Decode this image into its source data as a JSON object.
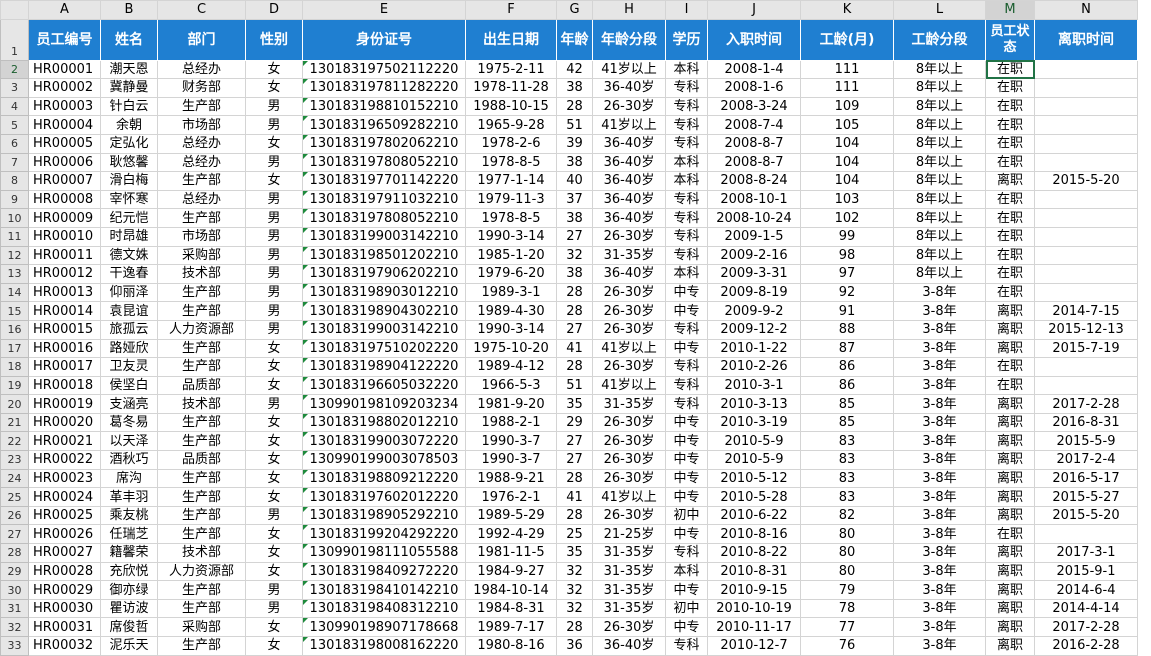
{
  "columns": [
    "A",
    "B",
    "C",
    "D",
    "E",
    "F",
    "G",
    "H",
    "I",
    "J",
    "K",
    "L",
    "M",
    "N"
  ],
  "header_row_number": "1",
  "headers": [
    "员工编号",
    "姓名",
    "部门",
    "性别",
    "身份证号",
    "出生日期",
    "年龄",
    "年龄分段",
    "学历",
    "入职时间",
    "工龄(月)",
    "工龄分段",
    "员工状态",
    "离职时间"
  ],
  "rows": [
    [
      "HR00001",
      "潮天恩",
      "总经办",
      "女",
      "130183197502112220",
      "1975-2-11",
      "42",
      "41岁以上",
      "本科",
      "2008-1-4",
      "111",
      "8年以上",
      "在职",
      ""
    ],
    [
      "HR00002",
      "冀静曼",
      "财务部",
      "女",
      "130183197811282220",
      "1978-11-28",
      "38",
      "36-40岁",
      "专科",
      "2008-1-6",
      "111",
      "8年以上",
      "在职",
      ""
    ],
    [
      "HR00003",
      "针白云",
      "生产部",
      "男",
      "130183198810152210",
      "1988-10-15",
      "28",
      "26-30岁",
      "专科",
      "2008-3-24",
      "109",
      "8年以上",
      "在职",
      ""
    ],
    [
      "HR00004",
      "余朝",
      "市场部",
      "男",
      "130183196509282210",
      "1965-9-28",
      "51",
      "41岁以上",
      "专科",
      "2008-7-4",
      "105",
      "8年以上",
      "在职",
      ""
    ],
    [
      "HR00005",
      "定弘化",
      "总经办",
      "女",
      "130183197802062210",
      "1978-2-6",
      "39",
      "36-40岁",
      "专科",
      "2008-8-7",
      "104",
      "8年以上",
      "在职",
      ""
    ],
    [
      "HR00006",
      "耿悠馨",
      "总经办",
      "男",
      "130183197808052210",
      "1978-8-5",
      "38",
      "36-40岁",
      "本科",
      "2008-8-7",
      "104",
      "8年以上",
      "在职",
      ""
    ],
    [
      "HR00007",
      "滑白梅",
      "生产部",
      "女",
      "130183197701142220",
      "1977-1-14",
      "40",
      "36-40岁",
      "本科",
      "2008-8-24",
      "104",
      "8年以上",
      "离职",
      "2015-5-20"
    ],
    [
      "HR00008",
      "宰怀寒",
      "总经办",
      "男",
      "130183197911032210",
      "1979-11-3",
      "37",
      "36-40岁",
      "专科",
      "2008-10-1",
      "103",
      "8年以上",
      "在职",
      ""
    ],
    [
      "HR00009",
      "纪元恺",
      "生产部",
      "男",
      "130183197808052210",
      "1978-8-5",
      "38",
      "36-40岁",
      "专科",
      "2008-10-24",
      "102",
      "8年以上",
      "在职",
      ""
    ],
    [
      "HR00010",
      "时昂雄",
      "市场部",
      "男",
      "130183199003142210",
      "1990-3-14",
      "27",
      "26-30岁",
      "专科",
      "2009-1-5",
      "99",
      "8年以上",
      "在职",
      ""
    ],
    [
      "HR00011",
      "德文姝",
      "采购部",
      "男",
      "130183198501202210",
      "1985-1-20",
      "32",
      "31-35岁",
      "专科",
      "2009-2-16",
      "98",
      "8年以上",
      "在职",
      ""
    ],
    [
      "HR00012",
      "干逸春",
      "技术部",
      "男",
      "130183197906202210",
      "1979-6-20",
      "38",
      "36-40岁",
      "本科",
      "2009-3-31",
      "97",
      "8年以上",
      "在职",
      ""
    ],
    [
      "HR00013",
      "仰丽泽",
      "生产部",
      "男",
      "130183198903012210",
      "1989-3-1",
      "28",
      "26-30岁",
      "中专",
      "2009-8-19",
      "92",
      "3-8年",
      "在职",
      ""
    ],
    [
      "HR00014",
      "袁昆谊",
      "生产部",
      "男",
      "130183198904302210",
      "1989-4-30",
      "28",
      "26-30岁",
      "中专",
      "2009-9-2",
      "91",
      "3-8年",
      "离职",
      "2014-7-15"
    ],
    [
      "HR00015",
      "旅孤云",
      "人力资源部",
      "男",
      "130183199003142210",
      "1990-3-14",
      "27",
      "26-30岁",
      "专科",
      "2009-12-2",
      "88",
      "3-8年",
      "离职",
      "2015-12-13"
    ],
    [
      "HR00016",
      "路娅欣",
      "生产部",
      "女",
      "130183197510202220",
      "1975-10-20",
      "41",
      "41岁以上",
      "中专",
      "2010-1-22",
      "87",
      "3-8年",
      "离职",
      "2015-7-19"
    ],
    [
      "HR00017",
      "卫友灵",
      "生产部",
      "女",
      "130183198904122220",
      "1989-4-12",
      "28",
      "26-30岁",
      "专科",
      "2010-2-26",
      "86",
      "3-8年",
      "在职",
      ""
    ],
    [
      "HR00018",
      "侯坚白",
      "品质部",
      "女",
      "130183196605032220",
      "1966-5-3",
      "51",
      "41岁以上",
      "专科",
      "2010-3-1",
      "86",
      "3-8年",
      "在职",
      ""
    ],
    [
      "HR00019",
      "支涵亮",
      "技术部",
      "男",
      "130990198109203234",
      "1981-9-20",
      "35",
      "31-35岁",
      "专科",
      "2010-3-13",
      "85",
      "3-8年",
      "离职",
      "2017-2-28"
    ],
    [
      "HR00020",
      "葛冬易",
      "生产部",
      "女",
      "130183198802012210",
      "1988-2-1",
      "29",
      "26-30岁",
      "中专",
      "2010-3-19",
      "85",
      "3-8年",
      "离职",
      "2016-8-31"
    ],
    [
      "HR00021",
      "以天泽",
      "生产部",
      "女",
      "130183199003072220",
      "1990-3-7",
      "27",
      "26-30岁",
      "中专",
      "2010-5-9",
      "83",
      "3-8年",
      "离职",
      "2015-5-9"
    ],
    [
      "HR00022",
      "酒秋巧",
      "品质部",
      "女",
      "130990199003078503",
      "1990-3-7",
      "27",
      "26-30岁",
      "中专",
      "2010-5-9",
      "83",
      "3-8年",
      "离职",
      "2017-2-4"
    ],
    [
      "HR00023",
      "席沟",
      "生产部",
      "女",
      "130183198809212220",
      "1988-9-21",
      "28",
      "26-30岁",
      "中专",
      "2010-5-12",
      "83",
      "3-8年",
      "离职",
      "2016-5-17"
    ],
    [
      "HR00024",
      "革丰羽",
      "生产部",
      "女",
      "130183197602012220",
      "1976-2-1",
      "41",
      "41岁以上",
      "中专",
      "2010-5-28",
      "83",
      "3-8年",
      "离职",
      "2015-5-27"
    ],
    [
      "HR00025",
      "乘友桃",
      "生产部",
      "男",
      "130183198905292210",
      "1989-5-29",
      "28",
      "26-30岁",
      "初中",
      "2010-6-22",
      "82",
      "3-8年",
      "离职",
      "2015-5-20"
    ],
    [
      "HR00026",
      "任瑞芝",
      "生产部",
      "女",
      "130183199204292220",
      "1992-4-29",
      "25",
      "21-25岁",
      "中专",
      "2010-8-16",
      "80",
      "3-8年",
      "在职",
      ""
    ],
    [
      "HR00027",
      "籍馨荣",
      "技术部",
      "女",
      "130990198111055588",
      "1981-11-5",
      "35",
      "31-35岁",
      "专科",
      "2010-8-22",
      "80",
      "3-8年",
      "离职",
      "2017-3-1"
    ],
    [
      "HR00028",
      "充欣悦",
      "人力资源部",
      "女",
      "130183198409272220",
      "1984-9-27",
      "32",
      "31-35岁",
      "本科",
      "2010-8-31",
      "80",
      "3-8年",
      "离职",
      "2015-9-1"
    ],
    [
      "HR00029",
      "御亦绿",
      "生产部",
      "男",
      "130183198410142210",
      "1984-10-14",
      "32",
      "31-35岁",
      "中专",
      "2010-9-15",
      "79",
      "3-8年",
      "离职",
      "2014-6-4"
    ],
    [
      "HR00030",
      "瞿访波",
      "生产部",
      "男",
      "130183198408312210",
      "1984-8-31",
      "32",
      "31-35岁",
      "初中",
      "2010-10-19",
      "78",
      "3-8年",
      "离职",
      "2014-4-14"
    ],
    [
      "HR00031",
      "席俊哲",
      "采购部",
      "女",
      "130990198907178668",
      "1989-7-17",
      "28",
      "26-30岁",
      "中专",
      "2010-11-17",
      "77",
      "3-8年",
      "离职",
      "2017-2-28"
    ],
    [
      "HR00032",
      "泥乐天",
      "生产部",
      "女",
      "130183198008162220",
      "1980-8-16",
      "36",
      "36-40岁",
      "专科",
      "2010-12-7",
      "76",
      "3-8年",
      "离职",
      "2016-2-28"
    ]
  ],
  "row_numbers": [
    "2",
    "3",
    "4",
    "5",
    "6",
    "7",
    "8",
    "9",
    "10",
    "11",
    "12",
    "13",
    "14",
    "15",
    "16",
    "17",
    "18",
    "19",
    "20",
    "21",
    "22",
    "23",
    "24",
    "25",
    "26",
    "27",
    "28",
    "29",
    "30",
    "31",
    "32",
    "33"
  ],
  "selection": {
    "active_cell": "M2",
    "selected_column": "M",
    "selected_row": "2"
  },
  "colors": {
    "header_fill": "#1f7fd1",
    "header_text": "#ffffff",
    "id_marker": "#1e8a3c",
    "selection": "#217346"
  }
}
